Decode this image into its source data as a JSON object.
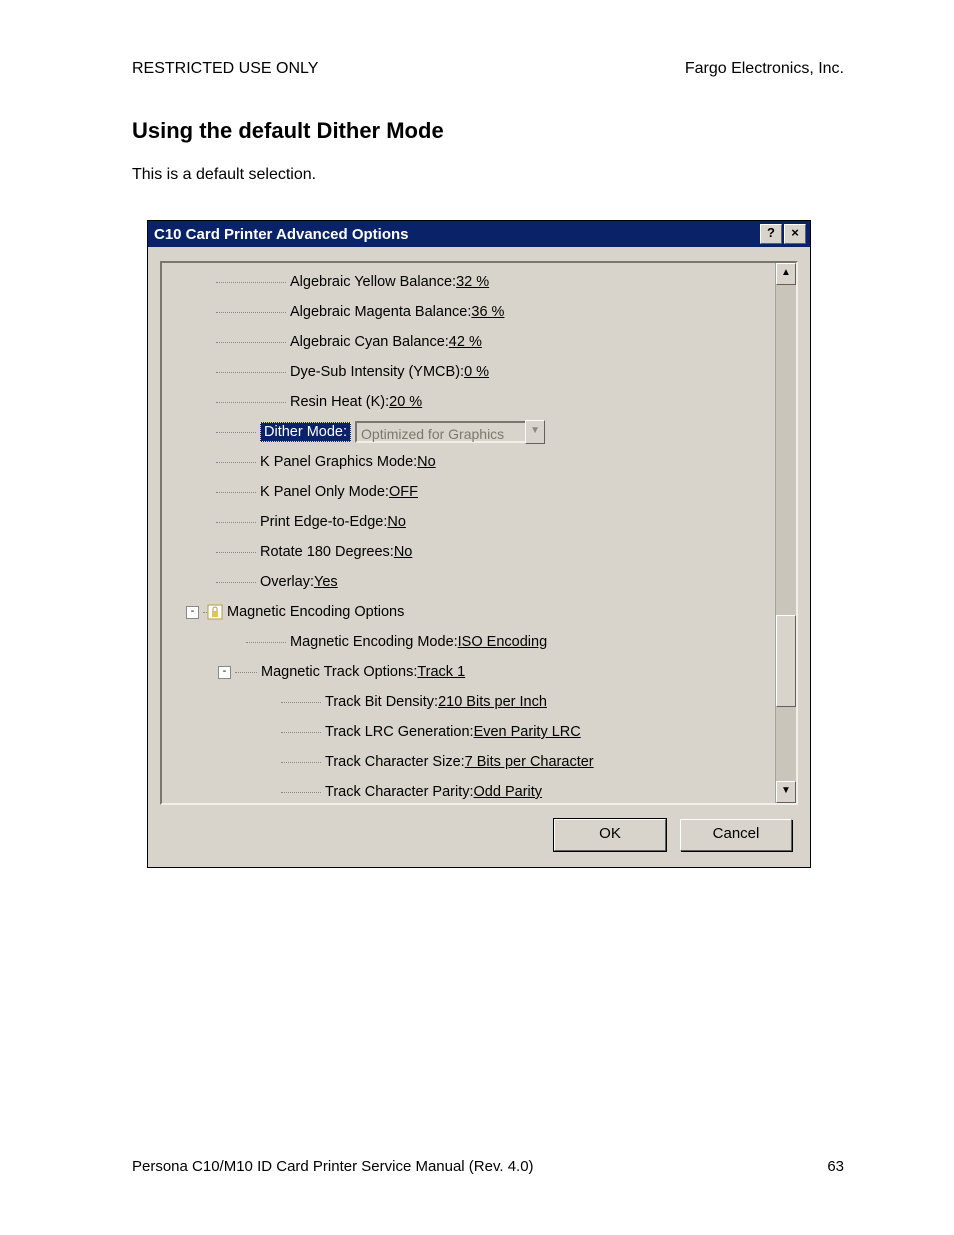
{
  "header": {
    "left": "RESTRICTED USE ONLY",
    "right": "Fargo Electronics, Inc."
  },
  "section_title": "Using the default Dither Mode",
  "body_text": "This is a default selection.",
  "dialog": {
    "title": "C10 Card Printer Advanced Options",
    "help_btn": "?",
    "close_btn": "×",
    "scroll_up": "▲",
    "scroll_down": "▼",
    "combo_arrow": "▼",
    "tree": {
      "r1": {
        "label": "Algebraic Yellow Balance: ",
        "value": "32 %"
      },
      "r2": {
        "label": "Algebraic Magenta Balance: ",
        "value": "36 %"
      },
      "r3": {
        "label": "Algebraic Cyan Balance: ",
        "value": "42 %"
      },
      "r4": {
        "label": "Dye-Sub Intensity (YMCB): ",
        "value": "0 %"
      },
      "r5": {
        "label": "Resin Heat (K): ",
        "value": "20 %"
      },
      "r6": {
        "label": "Dither Mode:",
        "selected_value": "Optimized for Graphics"
      },
      "r7": {
        "label": "K Panel Graphics Mode: ",
        "value": "No"
      },
      "r8": {
        "label": "K Panel Only Mode: ",
        "value": "OFF"
      },
      "r9": {
        "label": "Print Edge-to-Edge: ",
        "value": "No"
      },
      "r10": {
        "label": "Rotate 180 Degrees: ",
        "value": "No"
      },
      "r11": {
        "label": "Overlay: ",
        "value": "Yes"
      },
      "r12": {
        "expander": "-",
        "label": "Magnetic Encoding Options"
      },
      "r13": {
        "label": "Magnetic Encoding Mode: ",
        "value": "ISO Encoding"
      },
      "r14": {
        "expander": "-",
        "label": "Magnetic Track Options: ",
        "value": "Track 1"
      },
      "r15": {
        "label": "Track Bit Density: ",
        "value": "210 Bits per Inch"
      },
      "r16": {
        "label": "Track LRC Generation: ",
        "value": "Even Parity LRC"
      },
      "r17": {
        "label": "Track Character Size: ",
        "value": "7 Bits per Character"
      },
      "r18": {
        "label": "Track Character Parity: ",
        "value": "Odd Parity"
      }
    },
    "buttons": {
      "ok": "OK",
      "cancel": "Cancel"
    }
  },
  "footer": {
    "left": "Persona C10/M10 ID Card Printer Service Manual (Rev. 4.0)",
    "right": "63"
  }
}
